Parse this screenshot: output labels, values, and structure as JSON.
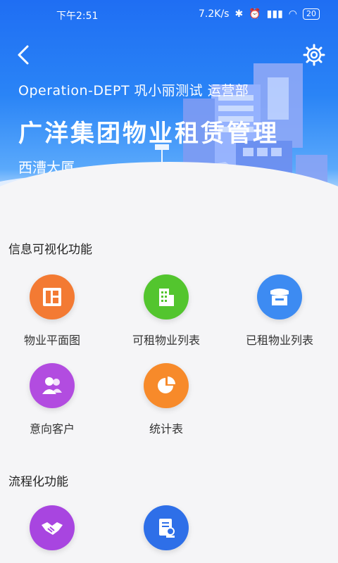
{
  "status": {
    "time": "下午2:51",
    "speed": "7.2K/s",
    "battery": "20"
  },
  "header": {
    "dept_line": "Operation-DEPT   巩小丽测试   运营部",
    "title": "广洋集团物业租赁管理",
    "building": "西漕大厦"
  },
  "sections": [
    {
      "title": "信息可视化功能",
      "items": [
        {
          "label": "物业平面图",
          "icon": "floorplan-icon",
          "color": "#f37a33"
        },
        {
          "label": "可租物业列表",
          "icon": "building-icon",
          "color": "#53c52e"
        },
        {
          "label": "已租物业列表",
          "icon": "store-icon",
          "color": "#3d8bf2"
        },
        {
          "label": "意向客户",
          "icon": "customers-icon",
          "color": "#b24ce0"
        },
        {
          "label": "统计表",
          "icon": "pie-chart-icon",
          "color": "#f78a2a"
        }
      ]
    },
    {
      "title": "流程化功能",
      "items": [
        {
          "label": "",
          "icon": "handshake-icon",
          "color": "#a845e0"
        },
        {
          "label": "",
          "icon": "contract-icon",
          "color": "#2e6fe8"
        }
      ]
    }
  ]
}
